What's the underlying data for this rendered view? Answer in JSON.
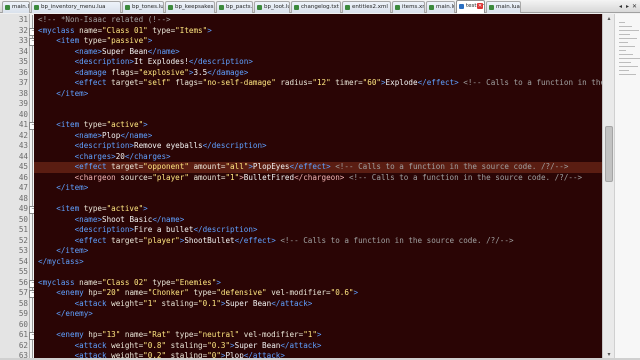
{
  "tabs": [
    {
      "label": "main.lua",
      "active": false
    },
    {
      "label": "bp_inventory_menu.lua",
      "active": false
    },
    {
      "label": "bp_tones.lua",
      "active": false
    },
    {
      "label": "bp_keepsakes.lua",
      "active": false
    },
    {
      "label": "bp_pacts.lua",
      "active": false
    },
    {
      "label": "bp_loot.lua",
      "active": false
    },
    {
      "label": "changelog.txt",
      "active": false
    },
    {
      "label": "entities2.xml",
      "active": false
    },
    {
      "label": "items.xml",
      "active": false
    },
    {
      "label": "main.lua",
      "active": false
    },
    {
      "label": "test.xml",
      "active": true
    },
    {
      "label": "main.lua",
      "active": false
    }
  ],
  "tab_scroll": {
    "left": "◂",
    "right": "▸",
    "close": "✕"
  },
  "editor": {
    "colors": {
      "background": "#2a0505",
      "tag": "#5fa0ff",
      "string": "#ffe680",
      "comment": "#a0a0a0",
      "current_line": "#5a1d12"
    },
    "current_line_number": "45",
    "lines": [
      {
        "n": "31",
        "tokens": [
          [
            "t-com",
            "<!-- *Non-Isaac related (!-->"
          ]
        ]
      },
      {
        "n": "32",
        "tokens": [
          [
            "t-b",
            "<myclass "
          ],
          [
            "t-at",
            "name="
          ],
          [
            "t-str",
            "\"Class 01\" "
          ],
          [
            "t-at",
            "type="
          ],
          [
            "t-str",
            "\"Items\""
          ],
          [
            "t-b",
            ">"
          ]
        ]
      },
      {
        "n": "33",
        "tokens": [
          [
            "t-b",
            "    <item "
          ],
          [
            "t-at",
            "type="
          ],
          [
            "t-str",
            "\"passive\""
          ],
          [
            "t-b",
            ">"
          ]
        ]
      },
      {
        "n": "34",
        "tokens": [
          [
            "t-b",
            "        <name>"
          ],
          [
            "t-txt",
            "Super Bean"
          ],
          [
            "t-b",
            "</name>"
          ]
        ]
      },
      {
        "n": "35",
        "tokens": [
          [
            "t-b",
            "        <description>"
          ],
          [
            "t-txt",
            "It Explodes!"
          ],
          [
            "t-b",
            "</description>"
          ]
        ]
      },
      {
        "n": "36",
        "tokens": [
          [
            "t-b",
            "        <damage "
          ],
          [
            "t-at",
            "flags="
          ],
          [
            "t-str",
            "\"explosive\""
          ],
          [
            "t-b",
            ">"
          ],
          [
            "t-txt",
            "3.5"
          ],
          [
            "t-b",
            "</damage>"
          ]
        ]
      },
      {
        "n": "37",
        "tokens": [
          [
            "t-b",
            "        <effect "
          ],
          [
            "t-at",
            "target="
          ],
          [
            "t-str",
            "\"self\" "
          ],
          [
            "t-at",
            "flags="
          ],
          [
            "t-str",
            "\"no-self-damage\" "
          ],
          [
            "t-at",
            "radius="
          ],
          [
            "t-str",
            "\"12\" "
          ],
          [
            "t-at",
            "timer="
          ],
          [
            "t-str",
            "\"60\""
          ],
          [
            "t-b",
            ">"
          ],
          [
            "t-txt",
            "Explode"
          ],
          [
            "t-b",
            "</effect>"
          ],
          [
            "t-com",
            " <!-- Calls to a function in the source code"
          ]
        ]
      },
      {
        "n": "38",
        "tokens": [
          [
            "t-b",
            "    </item>"
          ]
        ]
      },
      {
        "n": "39",
        "tokens": []
      },
      {
        "n": "40",
        "tokens": []
      },
      {
        "n": "41",
        "tokens": [
          [
            "t-b",
            "    <item "
          ],
          [
            "t-at",
            "type="
          ],
          [
            "t-str",
            "\"active\""
          ],
          [
            "t-b",
            ">"
          ]
        ]
      },
      {
        "n": "42",
        "tokens": [
          [
            "t-b",
            "        <name>"
          ],
          [
            "t-txt",
            "Plop"
          ],
          [
            "t-b",
            "</name>"
          ]
        ]
      },
      {
        "n": "43",
        "tokens": [
          [
            "t-b",
            "        <description>"
          ],
          [
            "t-txt",
            "Remove eyeballs"
          ],
          [
            "t-b",
            "</description>"
          ]
        ]
      },
      {
        "n": "44",
        "tokens": [
          [
            "t-b",
            "        <charges>"
          ],
          [
            "t-txt",
            "20"
          ],
          [
            "t-b",
            "</charges>"
          ]
        ]
      },
      {
        "n": "45",
        "tokens": [
          [
            "t-b",
            "        <effect "
          ],
          [
            "t-at",
            "target="
          ],
          [
            "t-str",
            "\"opponent\" "
          ],
          [
            "t-at",
            "amount="
          ],
          [
            "t-str",
            "\"all\""
          ],
          [
            "t-b",
            ">"
          ],
          [
            "t-txt",
            "PlopEyes"
          ],
          [
            "t-b",
            "</effect>"
          ],
          [
            "t-com",
            " <!-- Calls to a function in the source code. /?/-->"
          ]
        ]
      },
      {
        "n": "46",
        "tokens": [
          [
            "t-cb",
            "        <chargeon "
          ],
          [
            "t-at",
            "source="
          ],
          [
            "t-str",
            "\"player\" "
          ],
          [
            "t-at",
            "amount="
          ],
          [
            "t-str",
            "\"1\""
          ],
          [
            "t-cb",
            ">"
          ],
          [
            "t-txt",
            "BulletFired"
          ],
          [
            "t-cb",
            "</chargeon>"
          ],
          [
            "t-com",
            " <!-- Calls to a function in the source code. /?/-->"
          ]
        ]
      },
      {
        "n": "47",
        "tokens": [
          [
            "t-b",
            "    </item>"
          ]
        ]
      },
      {
        "n": "48",
        "tokens": []
      },
      {
        "n": "49",
        "tokens": [
          [
            "t-b",
            "    <item "
          ],
          [
            "t-at",
            "type="
          ],
          [
            "t-str",
            "\"active\""
          ],
          [
            "t-b",
            ">"
          ]
        ]
      },
      {
        "n": "50",
        "tokens": [
          [
            "t-b",
            "        <name>"
          ],
          [
            "t-txt",
            "Shoot Basic"
          ],
          [
            "t-b",
            "</name>"
          ]
        ]
      },
      {
        "n": "51",
        "tokens": [
          [
            "t-b",
            "        <description>"
          ],
          [
            "t-txt",
            "Fire a bullet"
          ],
          [
            "t-b",
            "</description>"
          ]
        ]
      },
      {
        "n": "52",
        "tokens": [
          [
            "t-b",
            "        <effect "
          ],
          [
            "t-at",
            "target="
          ],
          [
            "t-str",
            "\"player\""
          ],
          [
            "t-b",
            ">"
          ],
          [
            "t-txt",
            "ShootBullet"
          ],
          [
            "t-b",
            "</effect>"
          ],
          [
            "t-com",
            " <!-- Calls to a function in the source code. /?/-->"
          ]
        ]
      },
      {
        "n": "53",
        "tokens": [
          [
            "t-b",
            "    </item>"
          ]
        ]
      },
      {
        "n": "54",
        "tokens": [
          [
            "t-b",
            "</myclass>"
          ]
        ]
      },
      {
        "n": "55",
        "tokens": []
      },
      {
        "n": "56",
        "tokens": [
          [
            "t-b",
            "<myclass "
          ],
          [
            "t-at",
            "name="
          ],
          [
            "t-str",
            "\"Class 02\" "
          ],
          [
            "t-at",
            "type="
          ],
          [
            "t-str",
            "\"Enemies\""
          ],
          [
            "t-b",
            ">"
          ]
        ]
      },
      {
        "n": "57",
        "tokens": [
          [
            "t-b",
            "    <enemy "
          ],
          [
            "t-at",
            "hp="
          ],
          [
            "t-str",
            "\"20\" "
          ],
          [
            "t-at",
            "name="
          ],
          [
            "t-str",
            "\"Chonker\" "
          ],
          [
            "t-at",
            "type="
          ],
          [
            "t-str",
            "\"defensive\" "
          ],
          [
            "t-at",
            "vel-modifier="
          ],
          [
            "t-str",
            "\"0.6\""
          ],
          [
            "t-b",
            ">"
          ]
        ]
      },
      {
        "n": "58",
        "tokens": [
          [
            "t-b",
            "        <attack "
          ],
          [
            "t-at",
            "weight="
          ],
          [
            "t-str",
            "\"1\" "
          ],
          [
            "t-at",
            "staling="
          ],
          [
            "t-str",
            "\"0.1\""
          ],
          [
            "t-b",
            ">"
          ],
          [
            "t-txt",
            "Super Bean"
          ],
          [
            "t-b",
            "</attack>"
          ]
        ]
      },
      {
        "n": "59",
        "tokens": [
          [
            "t-b",
            "    </enemy>"
          ]
        ]
      },
      {
        "n": "60",
        "tokens": []
      },
      {
        "n": "61",
        "tokens": [
          [
            "t-b",
            "    <enemy "
          ],
          [
            "t-at",
            "hp="
          ],
          [
            "t-str",
            "\"13\" "
          ],
          [
            "t-at",
            "name="
          ],
          [
            "t-str",
            "\"Rat\" "
          ],
          [
            "t-at",
            "type="
          ],
          [
            "t-str",
            "\"neutral\" "
          ],
          [
            "t-at",
            "vel-modifier="
          ],
          [
            "t-str",
            "\"1\""
          ],
          [
            "t-b",
            ">"
          ]
        ]
      },
      {
        "n": "62",
        "tokens": [
          [
            "t-b",
            "        <attack "
          ],
          [
            "t-at",
            "weight="
          ],
          [
            "t-str",
            "\"0.8\" "
          ],
          [
            "t-at",
            "staling="
          ],
          [
            "t-str",
            "\"0.3\""
          ],
          [
            "t-b",
            ">"
          ],
          [
            "t-txt",
            "Super Bean"
          ],
          [
            "t-b",
            "</attack>"
          ]
        ]
      },
      {
        "n": "63",
        "tokens": [
          [
            "t-b",
            "        <attack "
          ],
          [
            "t-at",
            "weight="
          ],
          [
            "t-str",
            "\"0.2\" "
          ],
          [
            "t-at",
            "staling="
          ],
          [
            "t-str",
            "\"0\""
          ],
          [
            "t-b",
            ">"
          ],
          [
            "t-txt",
            "Plop"
          ],
          [
            "t-b",
            "</attack>"
          ]
        ]
      }
    ]
  },
  "scrollbar": {
    "up": "▴",
    "down": "▾"
  }
}
